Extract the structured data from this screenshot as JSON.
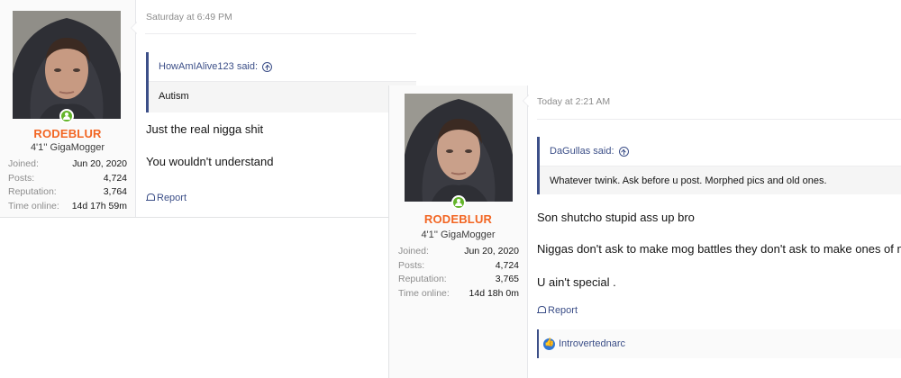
{
  "posts": [
    {
      "user": {
        "name": "RODEBLUR",
        "title": "4'1'' GigaMogger",
        "stats": [
          {
            "label": "Joined:",
            "value": "Jun 20, 2020"
          },
          {
            "label": "Posts:",
            "value": "4,724"
          },
          {
            "label": "Reputation:",
            "value": "3,764"
          },
          {
            "label": "Time online:",
            "value": "14d 17h 59m"
          }
        ]
      },
      "timestamp": "Saturday at 6:49 PM",
      "quote": {
        "author": "HowAmIAlive123 said:",
        "text": "Autism"
      },
      "messages": [
        "Just the real nigga shit",
        "You wouldn't understand"
      ],
      "report_label": "Report"
    },
    {
      "user": {
        "name": "RODEBLUR",
        "title": "4'1'' GigaMogger",
        "stats": [
          {
            "label": "Joined:",
            "value": "Jun 20, 2020"
          },
          {
            "label": "Posts:",
            "value": "4,724"
          },
          {
            "label": "Reputation:",
            "value": "3,765"
          },
          {
            "label": "Time online:",
            "value": "14d 18h 0m"
          }
        ]
      },
      "timestamp": "Today at 2:21 AM",
      "quote": {
        "author": "DaGullas said:",
        "text": "Whatever twink. Ask before u post. Morphed pics and old ones."
      },
      "messages": [
        "Son shutcho stupid ass up bro",
        "Niggas don't ask to make mog battles they don't ask to make ones of m",
        "U ain't special ."
      ],
      "report_label": "Report",
      "reaction_user": "Introvertednarc"
    }
  ],
  "colors": {
    "username": "#f26522",
    "link": "#3c4f88",
    "online": "#63b529",
    "like": "#2f77d6"
  }
}
